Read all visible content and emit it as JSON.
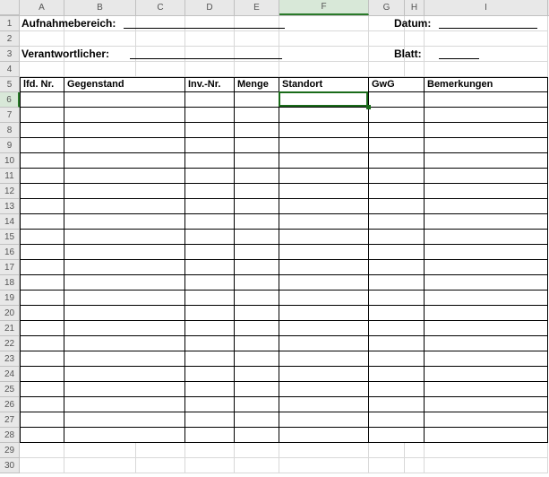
{
  "columns": [
    "A",
    "B",
    "C",
    "D",
    "E",
    "F",
    "G",
    "H",
    "I"
  ],
  "selected_column": "F",
  "selected_row": 6,
  "row_count": 30,
  "form": {
    "aufnahmebereich_label": "Aufnahmebereich:",
    "datum_label": "Datum:",
    "verantwortlicher_label": "Verantwortlicher:",
    "blatt_label": "Blatt:"
  },
  "table_headers": {
    "lfd_nr": "lfd. Nr.",
    "gegenstand": "Gegenstand",
    "inv_nr": "Inv.-Nr.",
    "menge": "Menge",
    "standort": "Standort",
    "gwg": "GwG",
    "bemerkungen": "Bemerkungen"
  },
  "col_widths": {
    "A": 50,
    "B": 80,
    "C": 55,
    "D": 55,
    "E": 50,
    "F": 100,
    "G": 40,
    "H": 22,
    "I": 138
  }
}
